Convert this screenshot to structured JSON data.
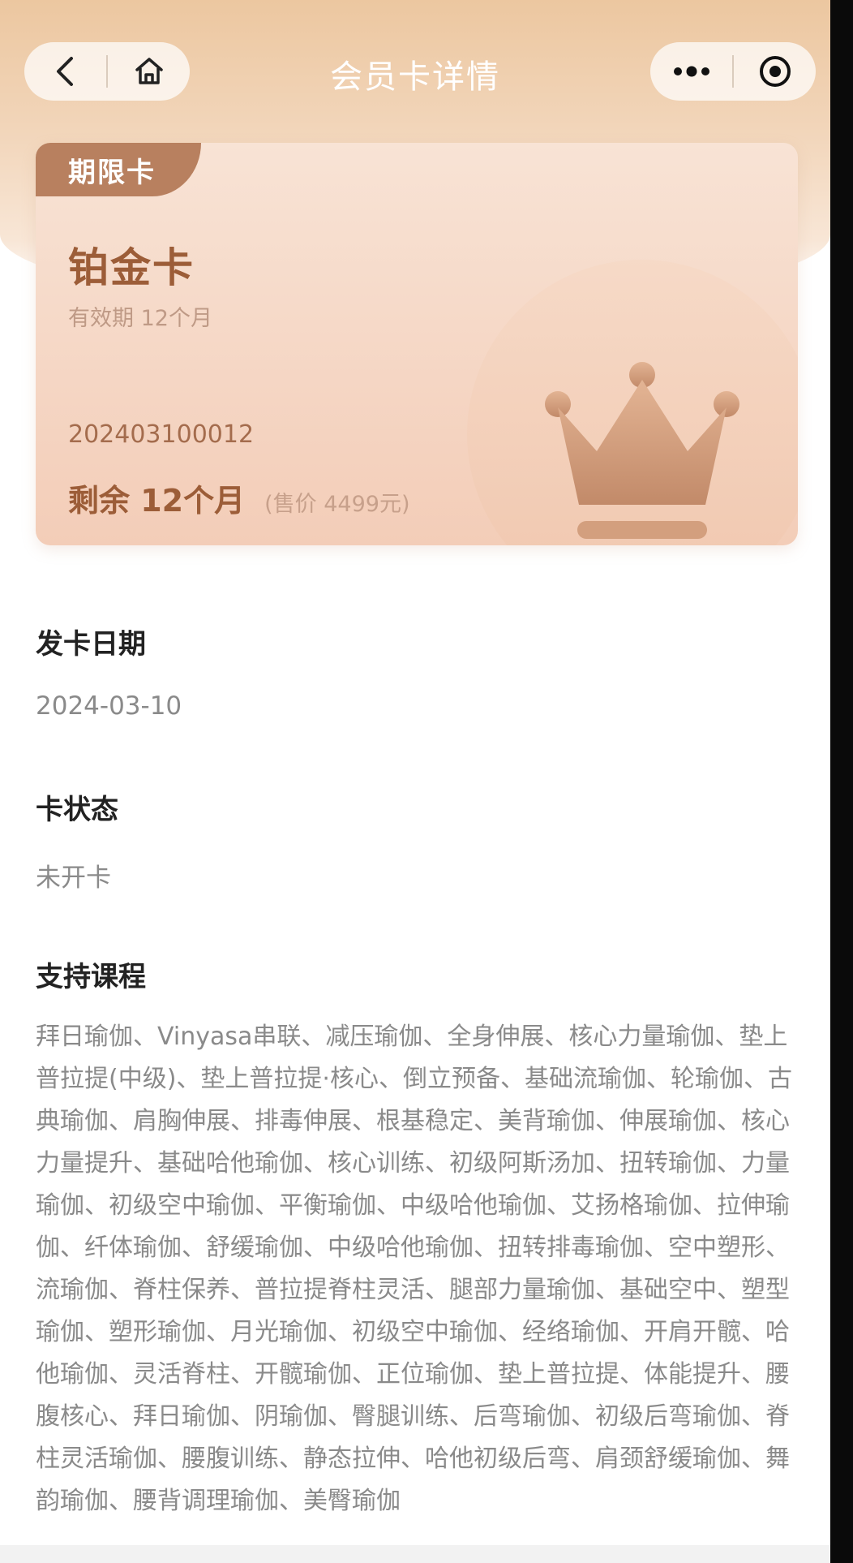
{
  "nav": {
    "title": "会员卡详情",
    "back_icon": "chevron-left-icon",
    "home_icon": "home-icon",
    "more_icon": "more-dots-icon",
    "close_icon": "target-circle-icon"
  },
  "card": {
    "tag": "期限卡",
    "name": "铂金卡",
    "validity": "有效期 12个月",
    "number": "202403100012",
    "remaining": "剩余 12个月",
    "price": "(售价 4499元)",
    "icon": "crown-icon"
  },
  "issue_date": {
    "label": "发卡日期",
    "value": "2024-03-10"
  },
  "status": {
    "label": "卡状态",
    "value": "未开卡"
  },
  "courses": {
    "label": "支持课程",
    "text": "拜日瑜伽、Vinyasa串联、减压瑜伽、全身伸展、核心力量瑜伽、垫上普拉提(中级)、垫上普拉提·核心、倒立预备、基础流瑜伽、轮瑜伽、古典瑜伽、肩胸伸展、排毒伸展、根基稳定、美背瑜伽、伸展瑜伽、核心力量提升、基础哈他瑜伽、核心训练、初级阿斯汤加、扭转瑜伽、力量瑜伽、初级空中瑜伽、平衡瑜伽、中级哈他瑜伽、艾扬格瑜伽、拉伸瑜伽、纤体瑜伽、舒缓瑜伽、中级哈他瑜伽、扭转排毒瑜伽、空中塑形、流瑜伽、脊柱保养、普拉提脊柱灵活、腿部力量瑜伽、基础空中、塑型瑜伽、塑形瑜伽、月光瑜伽、初级空中瑜伽、经络瑜伽、开肩开髋、哈他瑜伽、灵活脊柱、开髋瑜伽、正位瑜伽、垫上普拉提、体能提升、腰腹核心、拜日瑜伽、阴瑜伽、臀腿训练、后弯瑜伽、初级后弯瑜伽、脊柱灵活瑜伽、腰腹训练、静态拉伸、哈他初级后弯、肩颈舒缓瑜伽、舞韵瑜伽、腰背调理瑜伽、美臀瑜伽"
  },
  "colors": {
    "accent": "#9c5d38",
    "tag_bg": "#b8805f",
    "header_bg": "#ecc7a0"
  }
}
